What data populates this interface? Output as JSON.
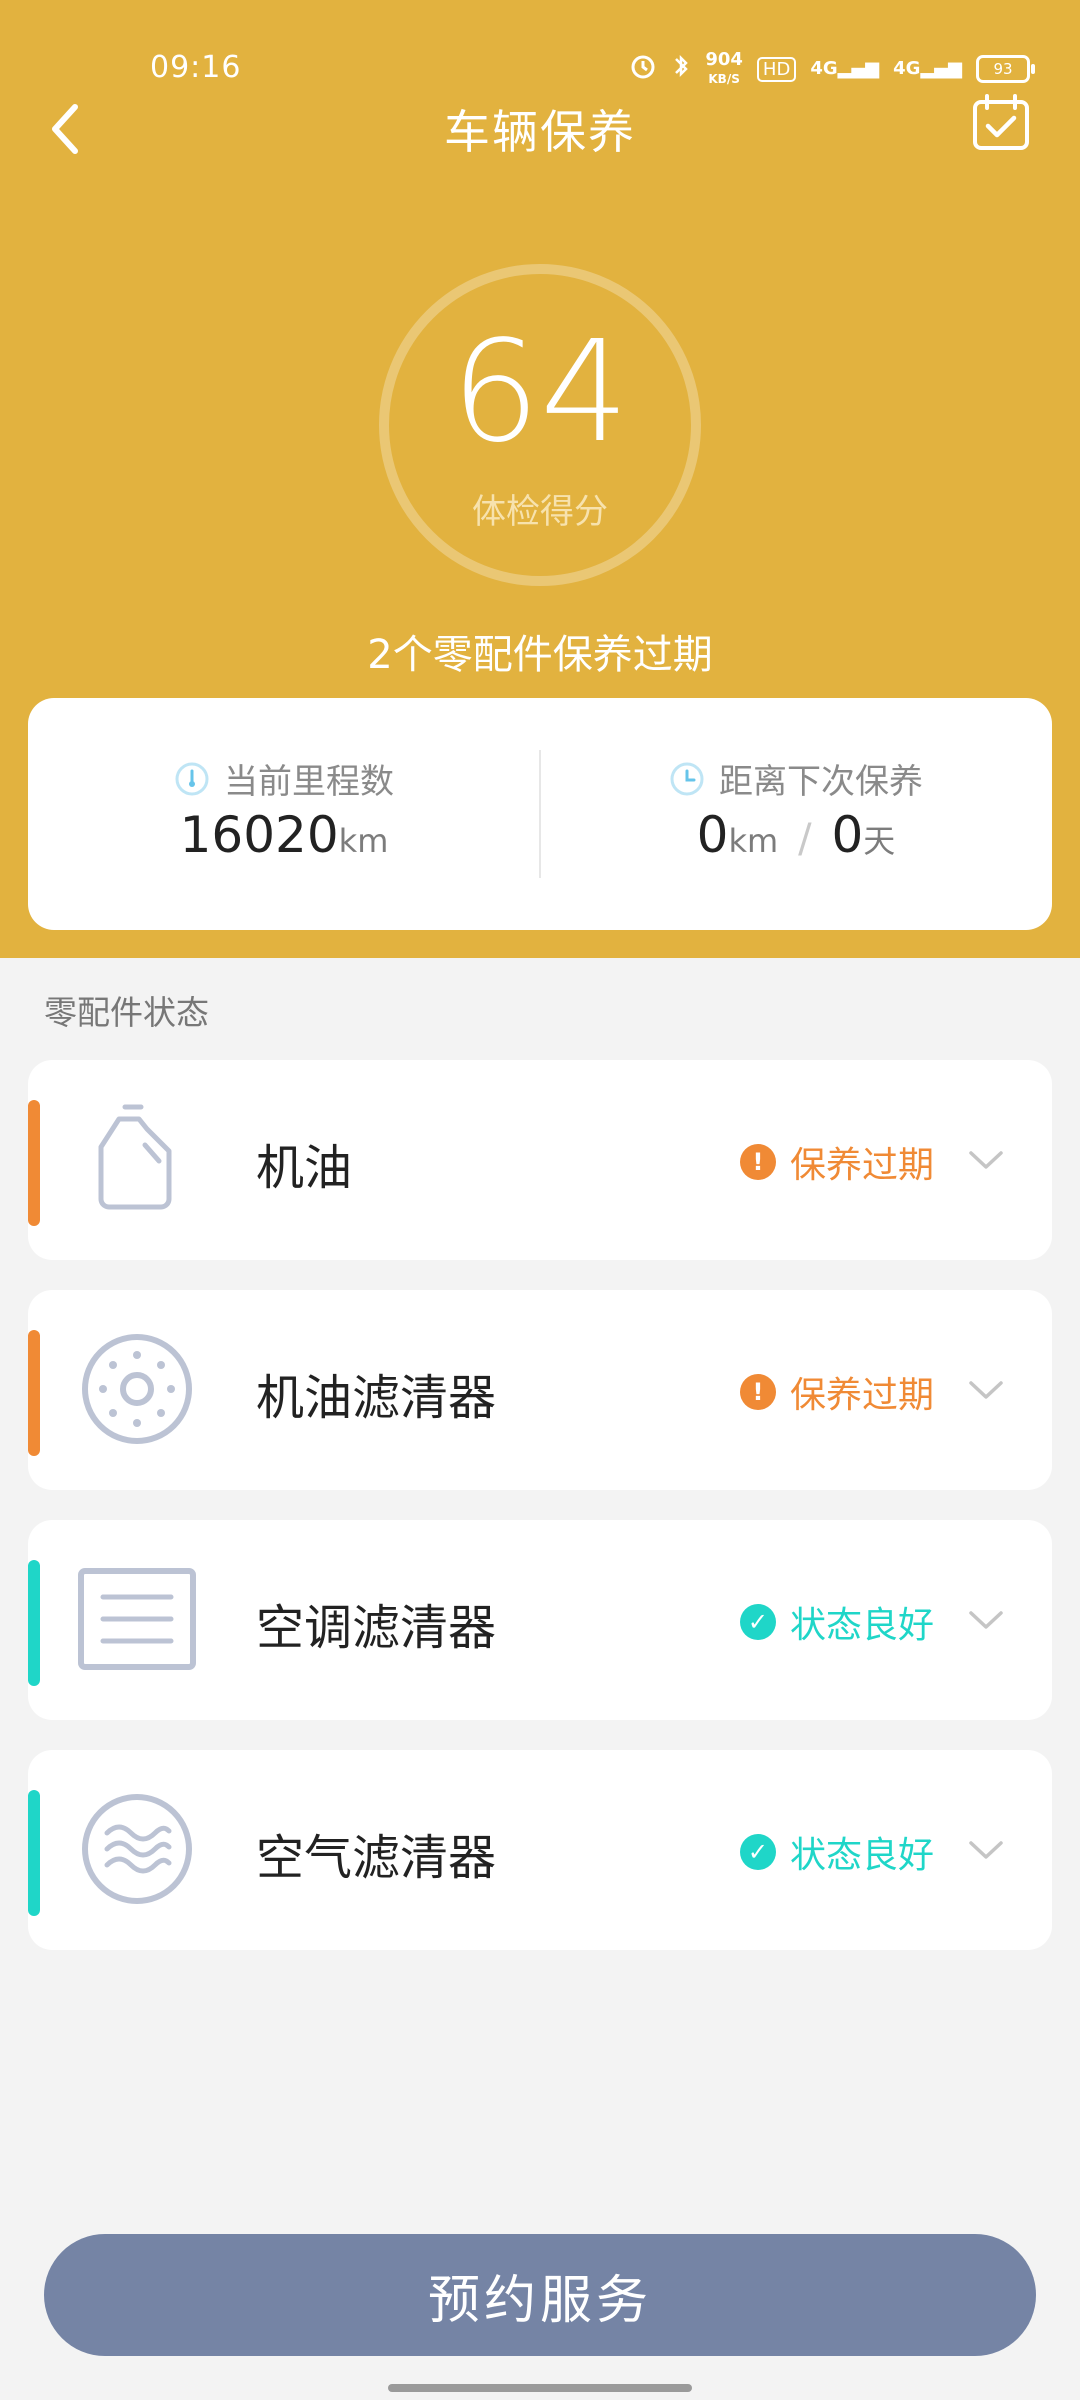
{
  "status_bar": {
    "time": "09:16",
    "net_speed_value": "904",
    "net_speed_unit": "KB/S",
    "hd_label": "HD",
    "signal1": "4G",
    "signal2": "4G",
    "battery": "93",
    "icons": [
      "alarm-icon",
      "bluetooth-icon",
      "signal-icon",
      "battery-icon"
    ]
  },
  "header": {
    "title": "车辆保养",
    "score": "64",
    "score_label": "体检得分",
    "expired_summary": "2个零配件保养过期"
  },
  "summary": {
    "mileage_label": "当前里程数",
    "mileage_value": "16020",
    "mileage_unit": "km",
    "next_label": "距离下次保养",
    "next_km": "0",
    "next_km_unit": "km",
    "separator": "/",
    "next_days": "0",
    "next_days_unit": "天"
  },
  "section_title": "零配件状态",
  "parts": [
    {
      "name": "机油",
      "status": "保养过期",
      "icon": "oil-bottle-icon",
      "status_icon": "!"
    },
    {
      "name": "机油滤清器",
      "status": "保养过期",
      "icon": "oil-filter-icon",
      "status_icon": "!"
    },
    {
      "name": "空调滤清器",
      "status": "状态良好",
      "icon": "ac-filter-icon",
      "status_icon": "✓"
    },
    {
      "name": "空气滤清器",
      "status": "状态良好",
      "icon": "air-filter-icon",
      "status_icon": "✓"
    }
  ],
  "colors": {
    "header": "#E2B23F",
    "expired": "#F08A35",
    "good": "#1FD6C8",
    "button": "#7584A5"
  },
  "book_button": "预约服务"
}
